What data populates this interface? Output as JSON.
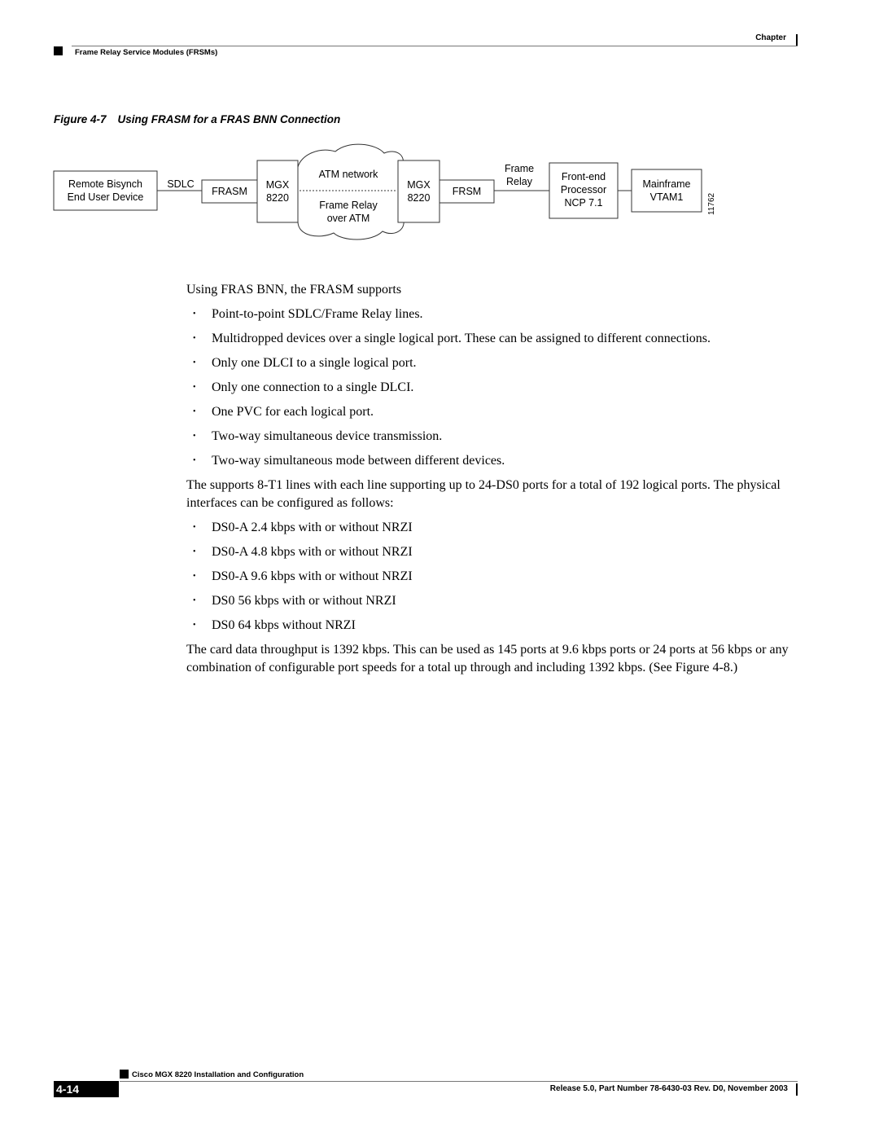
{
  "header": {
    "chapter_label": "Chapter",
    "section_title": "Frame Relay Service Modules (FRSMs)"
  },
  "figure": {
    "number": "Figure 4-7",
    "title": "Using FRASM for a FRAS BNN Connection",
    "figure_id": "11762",
    "nodes": {
      "remote_device": [
        "Remote Bisynch",
        "End User Device"
      ],
      "frasm": "FRASM",
      "mgx_left": [
        "MGX",
        "8220"
      ],
      "cloud_top": "ATM network",
      "cloud_bottom": [
        "Frame Relay",
        "over ATM"
      ],
      "mgx_right": [
        "MGX",
        "8220"
      ],
      "frsm": "FRSM",
      "front_end": [
        "Front-end",
        "Processor",
        "NCP 7.1"
      ],
      "mainframe": [
        "Mainframe",
        "VTAM1"
      ]
    },
    "links": {
      "sdlc": "SDLC",
      "frame_relay": [
        "Frame",
        "Relay"
      ]
    }
  },
  "content": {
    "intro": "Using FRAS BNN, the FRASM supports",
    "supports_list": [
      "Point-to-point SDLC/Frame Relay lines.",
      "Multidropped devices over a single logical port. These can be assigned to different connections.",
      "Only one DLCI to a single logical port.",
      "Only one connection to a single DLCI.",
      "One PVC for each logical port.",
      "Two-way simultaneous device transmission.",
      "Two-way simultaneous mode between different devices."
    ],
    "interfaces_para": "The supports 8-T1 lines with each line supporting up to 24-DS0 ports for a total of 192 logical ports. The physical interfaces can be configured as follows:",
    "interfaces_list": [
      "DS0-A 2.4 kbps with or without NRZI",
      "DS0-A 4.8 kbps with or without NRZI",
      "DS0-A 9.6 kbps with or without NRZI",
      "DS0 56 kbps with or without NRZI",
      "DS0 64 kbps without NRZI"
    ],
    "throughput_para": "The card data throughput is 1392 kbps. This can be used as 145 ports at 9.6 kbps ports or 24 ports at 56 kbps or any combination of configurable port speeds for a total up through and including 1392 kbps. (See Figure 4-8.)",
    "bullet_glyph": "•"
  },
  "footer": {
    "book_title": "Cisco MGX 8220 Installation and Configuration",
    "page_number": "4-14",
    "release_info": "Release 5.0, Part Number 78-6430-03 Rev. D0, November 2003"
  }
}
